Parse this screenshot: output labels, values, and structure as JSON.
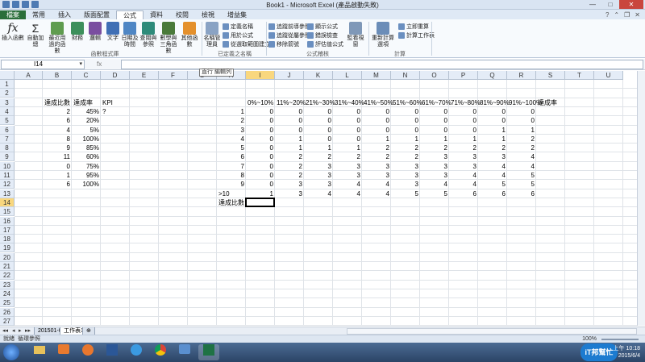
{
  "window": {
    "title": "Book1 - Microsoft Excel (產品啟動失敗)",
    "min": "—",
    "max": "□",
    "close": "✕"
  },
  "tabs": [
    "檔案",
    "常用",
    "插入",
    "版面配置",
    "公式",
    "資料",
    "校閱",
    "檢視",
    "增益集"
  ],
  "active_tab": "公式",
  "ribbon": {
    "insert_function": "插入函數",
    "autosum": "自動加總",
    "recent": "最近用過的函數",
    "financial": "財務",
    "logical": "邏輯",
    "text": "文字",
    "datetime": "日期及時間",
    "lookup": "查閱與參照",
    "math": "數學與三角函數",
    "more": "其他函數",
    "group_library": "函數程式庫",
    "name_manager": "名稱管理員",
    "define_name": "定義名稱",
    "use_in_formula": "用於公式",
    "create_from_selection": "從選取範圍建立",
    "group_names": "已定義之名稱",
    "trace_precedents": "追蹤前導參照",
    "trace_dependents": "追蹤從屬參照",
    "remove_arrows": "移除箭號",
    "show_formulas": "顯示公式",
    "error_checking": "錯誤檢查",
    "evaluate_formula": "評估值公式",
    "watch_window": "監看視窗",
    "group_auditing": "公式稽核",
    "calc_options": "重新計算選項",
    "calc_now": "立即重算",
    "calc_sheet": "計算工作表",
    "group_calc": "計算"
  },
  "formula_bar": {
    "name_box": "I14",
    "fx": "fx",
    "formula": ""
  },
  "tooltip": "直行 編輯列",
  "columns": [
    "A",
    "B",
    "C",
    "D",
    "E",
    "F",
    "G",
    "H",
    "I",
    "J",
    "K",
    "L",
    "M",
    "N",
    "O",
    "P",
    "Q",
    "R",
    "S",
    "T",
    "U"
  ],
  "selected_column": "I",
  "selected_row": 14,
  "rows": [
    "1",
    "2",
    "3",
    "4",
    "5",
    "6",
    "7",
    "8",
    "9",
    "10",
    "11",
    "12",
    "13",
    "14",
    "15",
    "16",
    "17",
    "18",
    "19",
    "20",
    "21",
    "22",
    "23",
    "24",
    "25",
    "26",
    "27"
  ],
  "left_table": {
    "headers": [
      "達成比數",
      "達成率",
      "KPI"
    ],
    "rows": [
      [
        "2",
        "45%",
        "?"
      ],
      [
        "6",
        "20%",
        ""
      ],
      [
        "4",
        "5%",
        ""
      ],
      [
        "8",
        "100%",
        ""
      ],
      [
        "9",
        "85%",
        ""
      ],
      [
        "11",
        "60%",
        ""
      ],
      [
        "0",
        "75%",
        ""
      ],
      [
        "1",
        "95%",
        ""
      ],
      [
        "6",
        "100%",
        ""
      ]
    ]
  },
  "right_table": {
    "headers": [
      "0%~10%",
      "11%~20%",
      "21%~30%",
      "31%~40%",
      "41%~50%",
      "51%~60%",
      "61%~70%",
      "71%~80%",
      "81%~90%",
      "91%~100%",
      "達成率"
    ],
    "row_labels": [
      "1",
      "2",
      "3",
      "4",
      "5",
      "6",
      "7",
      "8",
      "9",
      ">10"
    ],
    "rows": [
      [
        "0",
        "0",
        "0",
        "0",
        "0",
        "0",
        "0",
        "0",
        "0",
        "0"
      ],
      [
        "0",
        "0",
        "0",
        "0",
        "0",
        "0",
        "0",
        "0",
        "0",
        "0"
      ],
      [
        "0",
        "0",
        "0",
        "0",
        "0",
        "0",
        "0",
        "0",
        "1",
        "1"
      ],
      [
        "0",
        "1",
        "0",
        "0",
        "1",
        "1",
        "1",
        "1",
        "1",
        "2"
      ],
      [
        "0",
        "1",
        "1",
        "1",
        "2",
        "2",
        "2",
        "2",
        "2",
        "2"
      ],
      [
        "0",
        "2",
        "2",
        "2",
        "2",
        "2",
        "3",
        "3",
        "3",
        "4"
      ],
      [
        "0",
        "2",
        "3",
        "3",
        "3",
        "3",
        "3",
        "3",
        "4",
        "4"
      ],
      [
        "0",
        "2",
        "3",
        "3",
        "3",
        "3",
        "3",
        "4",
        "4",
        "5"
      ],
      [
        "0",
        "3",
        "3",
        "4",
        "4",
        "3",
        "4",
        "4",
        "5",
        "5"
      ],
      [
        "1",
        "3",
        "4",
        "4",
        "4",
        "5",
        "5",
        "6",
        "6",
        "6"
      ]
    ],
    "footer_label": "達成比數"
  },
  "sheets": [
    "201501-06",
    "工作表1"
  ],
  "active_sheet": "工作表1",
  "status": {
    "ready": "就緒",
    "circular": "循環參照",
    "zoom": "100%"
  },
  "clock": {
    "time": "上午 10:18",
    "date": "2015/6/4"
  },
  "brand": "iT邦幫忙"
}
